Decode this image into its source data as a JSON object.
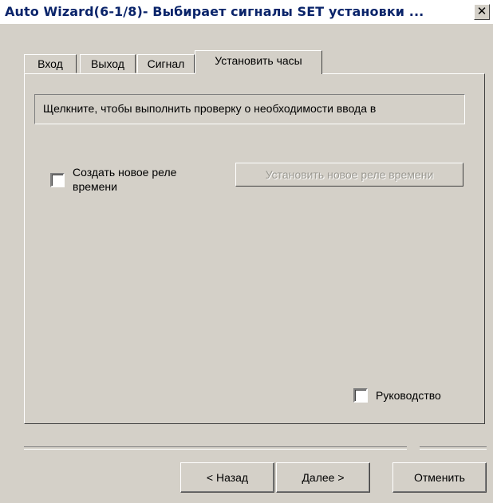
{
  "window": {
    "title": "Auto Wizard(6-1/8)- Выбирает сигналы SET установки ...",
    "close_glyph": "✕"
  },
  "tabs": [
    {
      "label": "Вход",
      "active": false
    },
    {
      "label": "Выход",
      "active": false
    },
    {
      "label": "Сигнал",
      "active": false
    },
    {
      "label": "Установить часы",
      "active": true
    }
  ],
  "panel": {
    "info_text": "Щелкните, чтобы выполнить проверку о необходимости ввода в",
    "create_relay_checkbox": {
      "label_line1": "Создать новое реле",
      "label_line2": "времени",
      "checked": false
    },
    "set_relay_button": {
      "label": "Установить новое реле времени",
      "enabled": false
    },
    "guide_checkbox": {
      "label": "Руководство",
      "checked": false
    }
  },
  "footer": {
    "back_label": "< Назад",
    "next_label": "Далее >",
    "cancel_label": "Отменить"
  }
}
